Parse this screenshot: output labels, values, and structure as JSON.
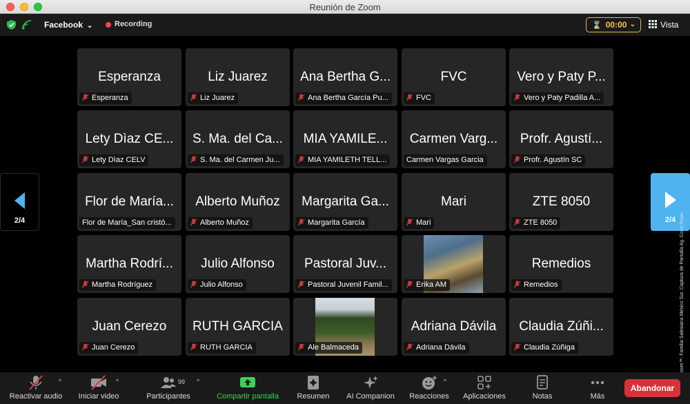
{
  "window": {
    "title": "Reunión de Zoom"
  },
  "topbar": {
    "meeting_name": "Facebook",
    "recording": "Recording",
    "timer": "00:00",
    "view_label": "Vista"
  },
  "pager": {
    "left_page": "2/4",
    "right_page": "2/4"
  },
  "tiles": [
    {
      "big": "Esperanza",
      "label": "Esperanza"
    },
    {
      "big": "Liz Juarez",
      "label": "Liz Juarez"
    },
    {
      "big": "Ana Bertha G...",
      "label": "Ana Bertha García Pu..."
    },
    {
      "big": "FVC",
      "label": "FVC"
    },
    {
      "big": "Vero y Paty P...",
      "label": "Vero y Paty Padilla A..."
    },
    {
      "big": "Lety Dìaz CE...",
      "label": "Lety Dìaz CELV"
    },
    {
      "big": "S. Ma. del Ca...",
      "label": "S. Ma. del Carmen Ju..."
    },
    {
      "big": "MIA YAMILE...",
      "label": "MIA YAMILETH TELL..."
    },
    {
      "big": "Carmen Varg...",
      "label": "Carmen Vargas Garcia"
    },
    {
      "big": "Profr. Agustí...",
      "label": "Profr. Agustín SC"
    },
    {
      "big": "Flor de María...",
      "label": "Flor de María_San cristó..."
    },
    {
      "big": "Alberto Muñoz",
      "label": "Alberto Muñoz"
    },
    {
      "big": "Margarita Ga...",
      "label": "Margarita García"
    },
    {
      "big": "Mari",
      "label": "Mari"
    },
    {
      "big": "ZTE 8050",
      "label": "ZTE 8050"
    },
    {
      "big": "Martha Rodrí...",
      "label": "Martha Rodríguez"
    },
    {
      "big": "Julio Alfonso",
      "label": "Julio Alfonso"
    },
    {
      "big": "Pastoral Juv...",
      "label": "Pastoral Juvenil Famil..."
    },
    {
      "big": "",
      "label": "Erika AM"
    },
    {
      "big": "Remedios",
      "label": "Remedios"
    },
    {
      "big": "Juan Cerezo",
      "label": "Juan Cerezo"
    },
    {
      "big": "RUTH GARCIA",
      "label": "RUTH GARCIA"
    },
    {
      "big": "",
      "label": "Ale Balmaceda"
    },
    {
      "big": "Adriana Dávila",
      "label": "Adriana Dávila"
    },
    {
      "big": "Claudia Zúñi...",
      "label": "Claudia Zúñiga"
    }
  ],
  "toolbar": {
    "unmute": "Reactivar audio",
    "start_video": "Iniciar video",
    "participants": "Participantes",
    "participants_count": "99",
    "share": "Compartir pantalla",
    "summary": "Resumen",
    "ai": "AI Companion",
    "reactions": "Reacciones",
    "apps": "Aplicaciones",
    "notes": "Notas",
    "more": "Más",
    "leave": "Abandonar"
  },
  "credit": "Cortesía © Zoom™. Familia Salesiana México Sur. Captura de Pantalla Ag. Coca Rojas"
}
